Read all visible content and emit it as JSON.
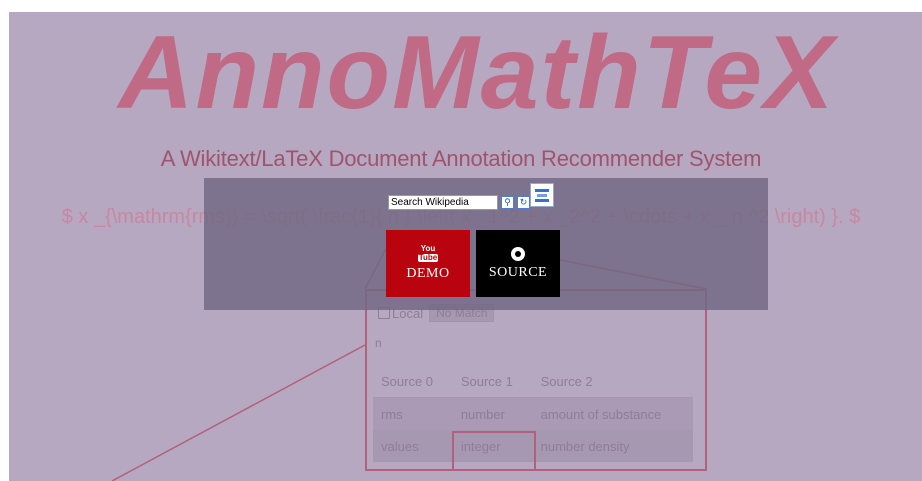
{
  "logo": {
    "text": "AnnoMathTeX"
  },
  "subtitle": "A Wikitext/LaTeX Document Annotation Recommender System",
  "formula": "$ x _{\\mathrm{rms}} = \\sqrt{ \\frac{1}{ n } \\left( x _1^2 + x _2^2 + \\cdots + x _ n ^2 \\right) }. $",
  "panel": {
    "local_label": "Local",
    "no_match_label": "No Match",
    "identifier": "n",
    "columns": [
      "Source 0",
      "Source 1",
      "Source 2"
    ],
    "rows": [
      [
        "rms",
        "number",
        "amount of substance"
      ],
      [
        "values",
        "integer",
        "number density"
      ]
    ]
  },
  "overlay": {
    "search_placeholder": "Search Wikipedia",
    "search_value": "Search Wikipedia",
    "search_icon": "magnifier-icon",
    "reset_icon": "refresh-icon",
    "wiki_logo_icon": "wikipedia-logo-icon",
    "demo": {
      "icon_top": "You",
      "icon_bottom": "Tube",
      "label": "DEMO"
    },
    "source": {
      "icon": "github-icon",
      "label": "SOURCE"
    }
  },
  "colors": {
    "page_bg": "#b6a8c0",
    "logo": "#c06a86",
    "accent_border": "#b3607c",
    "overlay": "#706882",
    "demo_bg": "#b9030f",
    "source_bg": "#000000"
  }
}
